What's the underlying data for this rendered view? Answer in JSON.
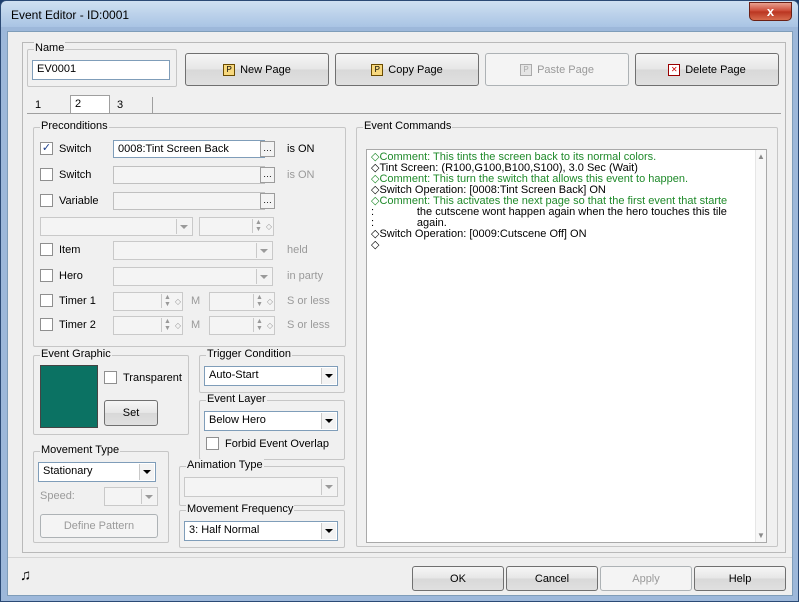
{
  "window": {
    "title": "Event Editor - ID:0001",
    "close_label": "x"
  },
  "name_group": {
    "label": "Name",
    "value": "EV0001"
  },
  "page_buttons": {
    "new": "New Page",
    "copy": "Copy Page",
    "paste": "Paste Page",
    "delete": "Delete Page"
  },
  "tabs": [
    "1",
    "2",
    "3"
  ],
  "preconditions": {
    "label": "Preconditions",
    "switch1": {
      "label": "Switch",
      "value": "0008:Tint Screen Back",
      "suffix": "is ON",
      "checked": true
    },
    "switch2": {
      "label": "Switch",
      "value": "",
      "suffix": "is ON"
    },
    "variable": {
      "label": "Variable",
      "value": ""
    },
    "item": {
      "label": "Item",
      "suffix": "held"
    },
    "hero": {
      "label": "Hero",
      "suffix": "in party"
    },
    "timer1": {
      "label": "Timer 1",
      "m": "M",
      "suffix": "S or less"
    },
    "timer2": {
      "label": "Timer 2",
      "m": "M",
      "suffix": "S or less"
    }
  },
  "event_graphic": {
    "label": "Event Graphic",
    "transparent": "Transparent",
    "set": "Set",
    "color": "#0b7263"
  },
  "trigger": {
    "label": "Trigger Condition",
    "value": "Auto-Start"
  },
  "layer": {
    "label": "Event Layer",
    "value": "Below Hero",
    "forbid": "Forbid Event Overlap"
  },
  "movement_type": {
    "label": "Movement Type",
    "value": "Stationary",
    "speed_label": "Speed:",
    "define": "Define Pattern"
  },
  "animation_type": {
    "label": "Animation Type",
    "value": ""
  },
  "movement_frequency": {
    "label": "Movement Frequency",
    "value": "3: Half Normal"
  },
  "event_commands": {
    "label": "Event Commands",
    "lines": [
      {
        "text": "◇Comment: This tints the screen back to its normal colors.",
        "green": true
      },
      {
        "text": "◇Tint Screen: (R100,G100,B100,S100), 3.0 Sec (Wait)",
        "green": false
      },
      {
        "text": "◇Comment: This turn the switch that allows this event to happen.",
        "green": true
      },
      {
        "text": "◇Switch Operation: [0008:Tint Screen Back] ON",
        "green": false
      },
      {
        "text": "◇Comment: This activates the next page so that the first event that starte",
        "green": true
      },
      {
        "text": ":              the cutscene wont happen again when the hero touches this tile",
        "green": false
      },
      {
        "text": ":              again.",
        "green": false
      },
      {
        "text": "◇Switch Operation: [0009:Cutscene Off] ON",
        "green": false
      },
      {
        "text": "◇",
        "green": false
      }
    ]
  },
  "footer": {
    "ok": "OK",
    "cancel": "Cancel",
    "apply": "Apply",
    "help": "Help",
    "music_icon": "music-note-icon"
  }
}
